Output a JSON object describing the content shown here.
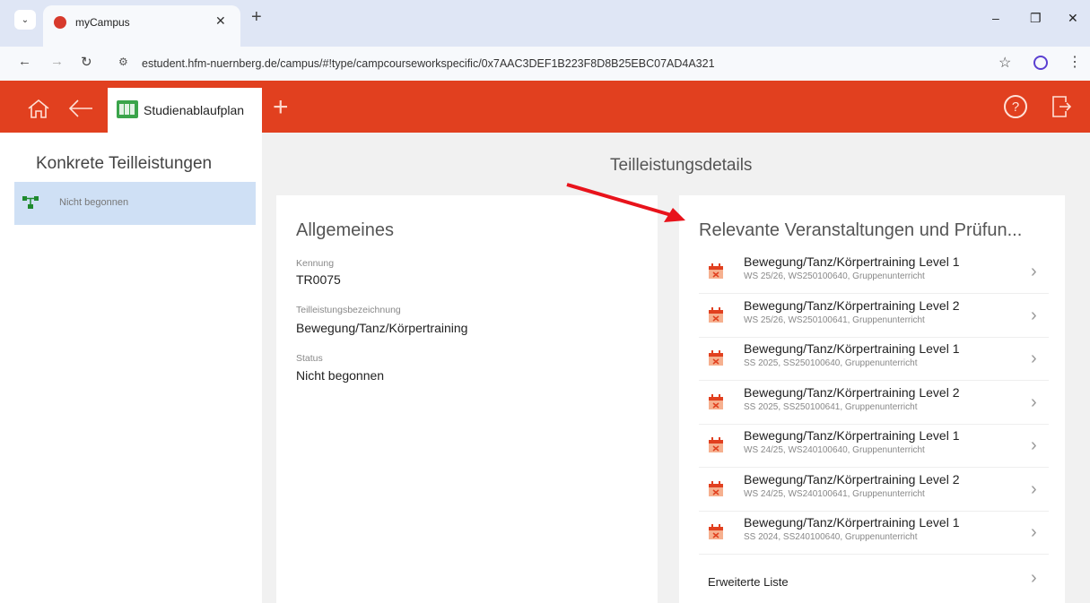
{
  "browser": {
    "tab_title": "myCampus",
    "url": "estudent.hfm-nuernberg.de/campus/#!type/campcourseworkspecific/0x7AAC3DEF1B223F8D8B25EBC07AD4A321",
    "tab_menu_icon": "chevron-down-icon",
    "tab_close_icon": "close-icon",
    "new_tab_icon": "plus-icon"
  },
  "appbar": {
    "tab_label": "Studienablaufplan",
    "colors": {
      "bar": "#e1401f"
    }
  },
  "left": {
    "title": "Konkrete Teilleistungen",
    "items": [
      {
        "label": "Nicht begonnen"
      }
    ]
  },
  "main": {
    "title": "Teilleistungsdetails",
    "general": {
      "heading": "Allgemeines",
      "fields": [
        {
          "label": "Kennung",
          "value": "TR0075"
        },
        {
          "label": "Teilleistungsbezeichnung",
          "value": "Bewegung/Tanz/Körpertraining"
        },
        {
          "label": "Status",
          "value": "Nicht begonnen"
        }
      ]
    },
    "related": {
      "heading": "Relevante Veranstaltungen und Prüfun...",
      "items": [
        {
          "title": "Bewegung/Tanz/Körpertraining Level 1",
          "sub": "WS 25/26, WS250100640, Gruppenunterricht"
        },
        {
          "title": "Bewegung/Tanz/Körpertraining Level 2",
          "sub": "WS 25/26, WS250100641, Gruppenunterricht"
        },
        {
          "title": "Bewegung/Tanz/Körpertraining Level 1",
          "sub": "SS 2025, SS250100640, Gruppenunterricht"
        },
        {
          "title": "Bewegung/Tanz/Körpertraining Level 2",
          "sub": "SS 2025, SS250100641, Gruppenunterricht"
        },
        {
          "title": "Bewegung/Tanz/Körpertraining Level 1",
          "sub": "WS 24/25, WS240100640, Gruppenunterricht"
        },
        {
          "title": "Bewegung/Tanz/Körpertraining Level 2",
          "sub": "WS 24/25, WS240100641, Gruppenunterricht"
        },
        {
          "title": "Bewegung/Tanz/Körpertraining Level 1",
          "sub": "SS 2024, SS240100640, Gruppenunterricht"
        }
      ],
      "extended_label": "Erweiterte Liste"
    }
  }
}
